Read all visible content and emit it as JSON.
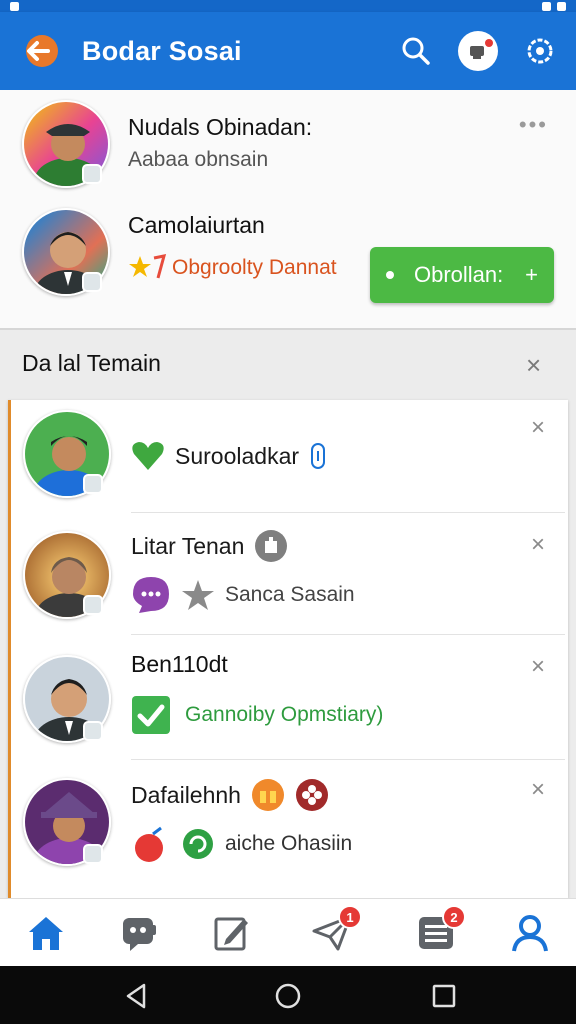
{
  "app": {
    "title": "Bodar Sosai"
  },
  "colors": {
    "primary": "#1a73d6",
    "accent_green": "#4cb944",
    "badge_red": "#e53935",
    "link_blue": "#1a73d6"
  },
  "header_icons": [
    "back-arrow-icon",
    "search-icon",
    "profile-avatar-icon",
    "settings-gear-icon"
  ],
  "top_users": [
    {
      "name": "Nudals Obinadan:",
      "subtitle": "Aabaa obnsain"
    },
    {
      "name": "Camolaiurtan",
      "subtitle": "Obgroolty Dannat"
    }
  ],
  "top_action": {
    "label": "Obrollan:",
    "plus": "+"
  },
  "more_label": "•••",
  "section": {
    "title": "Da lal Temain",
    "close": "×"
  },
  "list_items": [
    {
      "name": "Surooladkar",
      "detail": ""
    },
    {
      "name": "Litar Tenan",
      "detail": "Sanca Sasain"
    },
    {
      "name": "Ben110dt",
      "detail": "Gannoiby Opmstiary)"
    },
    {
      "name": "Dafailehnh",
      "detail": "aiche Ohasiin"
    }
  ],
  "close_symbol": "×",
  "bottom_nav": [
    {
      "icon": "home-icon",
      "badge": ""
    },
    {
      "icon": "chat-bot-icon",
      "badge": ""
    },
    {
      "icon": "edit-icon",
      "badge": ""
    },
    {
      "icon": "send-icon",
      "badge": "1"
    },
    {
      "icon": "list-icon",
      "badge": "2"
    },
    {
      "icon": "profile-icon",
      "badge": ""
    }
  ]
}
